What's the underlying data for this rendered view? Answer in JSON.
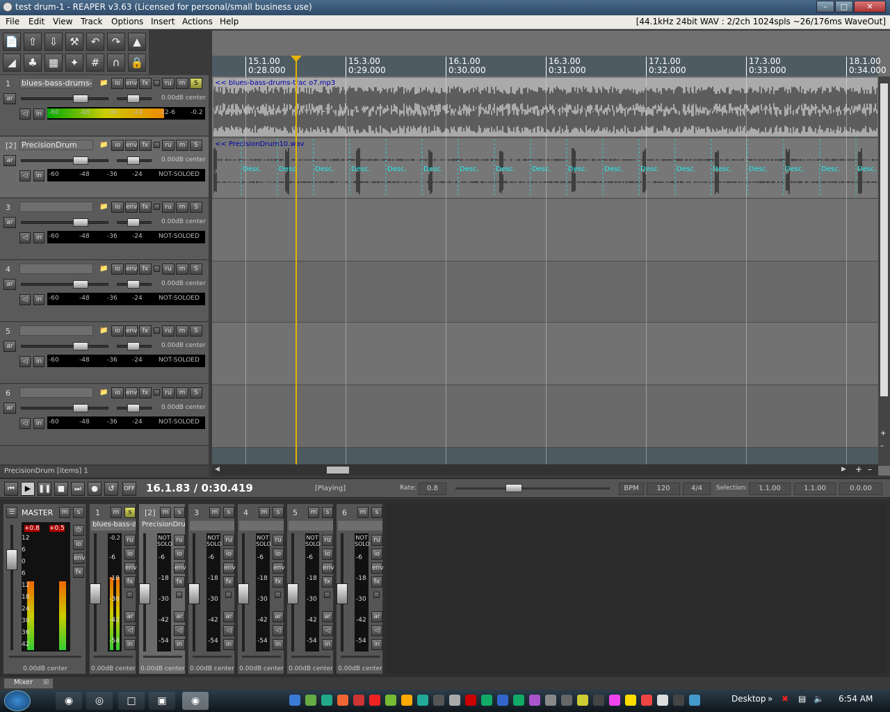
{
  "window": {
    "title": "test drum-1 - REAPER v3.63 (Licensed for personal/small business use)"
  },
  "menu": {
    "items": [
      "File",
      "Edit",
      "View",
      "Track",
      "Options",
      "Insert",
      "Actions",
      "Help"
    ],
    "audio_info": "[44.1kHz 24bit WAV : 2/2ch 1024spls ~26/176ms WaveOut]"
  },
  "toolbar": {
    "icons": [
      "new-project-icon",
      "open-project-icon",
      "save-project-icon",
      "preferences-icon",
      "undo-icon",
      "redo-icon",
      "metronome-icon",
      "ripple-edit-icon",
      "grouping-icon",
      "snap-icon",
      "envelope-lock-icon",
      "grid-icon",
      "loop-icon",
      "lock-icon"
    ]
  },
  "tracks": [
    {
      "num": "1",
      "name": "blues-bass-drums-tracl",
      "vol": "0.00dB",
      "pan": "center",
      "meter": [
        "-60",
        "-48",
        "-36",
        "-24",
        "-12",
        "-6",
        "-0.2"
      ],
      "selected": false,
      "solo": true,
      "meter_level": 0.74
    },
    {
      "num": "[2]",
      "name": "PrecisionDrum",
      "vol": "0.00dB",
      "pan": "center",
      "meter": [
        "-60",
        "-48",
        "-36",
        "-24",
        "NOT-SOLOED"
      ],
      "selected": true,
      "solo": false
    },
    {
      "num": "3",
      "name": "",
      "vol": "0.00dB",
      "pan": "center",
      "meter": [
        "-60",
        "-48",
        "-36",
        "-24",
        "NOT-SOLOED"
      ],
      "selected": false,
      "solo": false
    },
    {
      "num": "4",
      "name": "",
      "vol": "0.00dB",
      "pan": "center",
      "meter": [
        "-60",
        "-48",
        "-36",
        "-24",
        "NOT-SOLOED"
      ],
      "selected": false,
      "solo": false
    },
    {
      "num": "5",
      "name": "",
      "vol": "0.00dB",
      "pan": "center",
      "meter": [
        "-60",
        "-48",
        "-36",
        "-24",
        "NOT-SOLOED"
      ],
      "selected": false,
      "solo": false
    },
    {
      "num": "6",
      "name": "",
      "vol": "0.00dB",
      "pan": "center",
      "meter": [
        "-60",
        "-48",
        "-36",
        "-24",
        "NOT-SOLOED"
      ],
      "selected": false,
      "solo": false
    }
  ],
  "track_buttons": {
    "io": "io",
    "env": "env",
    "fx": "fx",
    "rec_mode": "ru",
    "mute": "m",
    "solo": "S",
    "arm": "ar",
    "monitor": "in"
  },
  "ruler": [
    {
      "bar": "15.1.00",
      "time": "0:28.000"
    },
    {
      "bar": "15.3.00",
      "time": "0:29.000"
    },
    {
      "bar": "16.1.00",
      "time": "0:30.000"
    },
    {
      "bar": "16.3.00",
      "time": "0:31.000"
    },
    {
      "bar": "17.1.00",
      "time": "0:32.000"
    },
    {
      "bar": "17.3.00",
      "time": "0:33.000"
    },
    {
      "bar": "18.1.00",
      "time": "0:34.000"
    }
  ],
  "items": {
    "track1": "<< blues-bass-drums-trac o7.mp3",
    "track2": "<< PrecisionDrum10.wav",
    "marker_label": "Desc."
  },
  "status_line": "PrecisionDrum [items] 1",
  "transport": {
    "position": "16.1.83 / 0:30.419",
    "state": "[Playing]",
    "rate_label": "Rate:",
    "rate": "0.8",
    "bpm_label": "BPM",
    "bpm": "120",
    "timesig": "4/4",
    "selection_label": "Selection:",
    "sel_start": "1.1.00",
    "sel_end": "1.1.00",
    "sel_len": "0.0.00",
    "off": "OFF"
  },
  "mixer": {
    "tab": "Mixer",
    "master": {
      "name": "MASTER",
      "peak_l": "+0.8",
      "peak_r": "+0.5",
      "vol": "0.00dB center",
      "scale": [
        "12",
        "6",
        "0",
        "6",
        "12",
        "18",
        "24",
        "30",
        "36",
        "42"
      ],
      "meter_level": 0.55
    },
    "strips": [
      {
        "num": "1",
        "name": "blues-bass-dru",
        "peak": "-0.2",
        "vol": "0.00dB center",
        "solo": true,
        "meter_level": 0.62
      },
      {
        "num": "[2]",
        "name": "PrecisionDrum",
        "peak": "NOT SOLO",
        "vol": "0.00dB center",
        "selected": true
      },
      {
        "num": "3",
        "name": "",
        "peak": "NOT SOLO",
        "vol": "0.00dB center"
      },
      {
        "num": "4",
        "name": "",
        "peak": "NOT SOLO",
        "vol": "0.00dB center"
      },
      {
        "num": "5",
        "name": "",
        "peak": "NOT SOLO",
        "vol": "0.00dB center"
      },
      {
        "num": "6",
        "name": "",
        "peak": "NOT SOLO",
        "vol": "0.00dB center"
      }
    ],
    "strip_scale": [
      "-6",
      "-18",
      "-30",
      "-42",
      "-54"
    ]
  },
  "taskbar": {
    "desktop": "Desktop",
    "clock": "6:54 AM"
  }
}
